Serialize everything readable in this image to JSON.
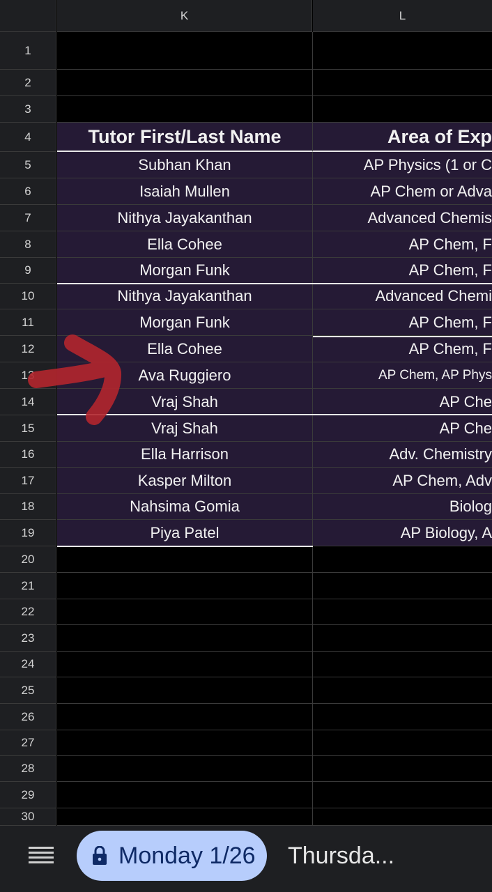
{
  "columns": {
    "k": "K",
    "l": "L"
  },
  "rows": [
    {
      "num": "1",
      "k": "",
      "l": ""
    },
    {
      "num": "2",
      "k": "",
      "l": ""
    },
    {
      "num": "3",
      "k": "",
      "l": ""
    },
    {
      "num": "4",
      "k": "Tutor First/Last Name",
      "l": "Area of Exp"
    },
    {
      "num": "5",
      "k": "Subhan Khan",
      "l": "AP Physics (1 or C"
    },
    {
      "num": "6",
      "k": "Isaiah Mullen",
      "l": "AP Chem or Adva"
    },
    {
      "num": "7",
      "k": "Nithya Jayakanthan",
      "l": "Advanced Chemis"
    },
    {
      "num": "8",
      "k": "Ella Cohee",
      "l": "AP Chem, F"
    },
    {
      "num": "9",
      "k": "Morgan Funk",
      "l": "AP Chem, F"
    },
    {
      "num": "10",
      "k": "Nithya Jayakanthan",
      "l": "Advanced Chemi"
    },
    {
      "num": "11",
      "k": "Morgan Funk",
      "l": "AP Chem, F"
    },
    {
      "num": "12",
      "k": "Ella Cohee",
      "l": "AP Chem, F"
    },
    {
      "num": "13",
      "k": "Ava Ruggiero",
      "l": "AP Chem, AP Phys"
    },
    {
      "num": "14",
      "k": "Vraj Shah",
      "l": "AP Che"
    },
    {
      "num": "15",
      "k": "Vraj Shah",
      "l": "AP Che"
    },
    {
      "num": "16",
      "k": "Ella Harrison",
      "l": "Adv. Chemistry"
    },
    {
      "num": "17",
      "k": "Kasper Milton",
      "l": "AP Chem, Adv"
    },
    {
      "num": "18",
      "k": "Nahsima Gomia",
      "l": "Biolog"
    },
    {
      "num": "19",
      "k": "Piya Patel",
      "l": "AP Biology,  A"
    },
    {
      "num": "20",
      "k": "",
      "l": ""
    },
    {
      "num": "21",
      "k": "",
      "l": ""
    },
    {
      "num": "22",
      "k": "",
      "l": ""
    },
    {
      "num": "23",
      "k": "",
      "l": ""
    },
    {
      "num": "24",
      "k": "",
      "l": ""
    },
    {
      "num": "25",
      "k": "",
      "l": ""
    },
    {
      "num": "26",
      "k": "",
      "l": ""
    },
    {
      "num": "27",
      "k": "",
      "l": ""
    },
    {
      "num": "28",
      "k": "",
      "l": ""
    },
    {
      "num": "29",
      "k": "",
      "l": ""
    },
    {
      "num": "30",
      "k": "",
      "l": ""
    }
  ],
  "tabs": {
    "active": "Monday 1/26",
    "next": "Thursda..."
  },
  "colors": {
    "filled_cell": "#251a35",
    "annotation_arrow": "#b3262e",
    "active_tab": "#b7cdfc"
  }
}
